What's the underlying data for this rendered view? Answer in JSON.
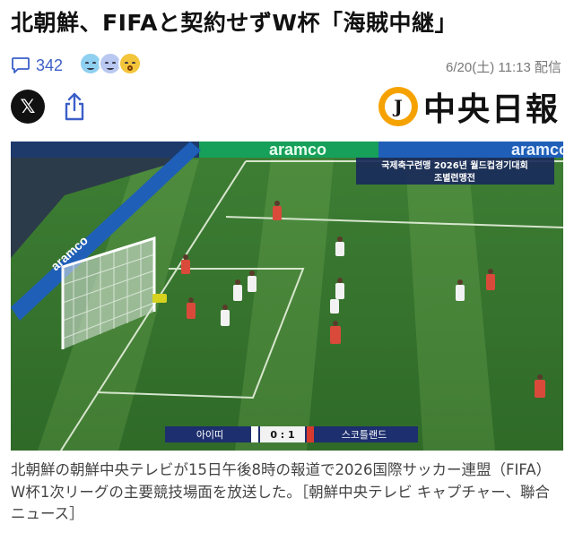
{
  "article": {
    "headline": "北朝鮮、FIFAと契約せずW杯「海賊中継」",
    "comment_count": "342",
    "date": "6/20(土) 11:13 配信",
    "caption": "北朝鮮の朝鮮中央テレビが15日午後8時の報道で2026国際サッカー連盟（FIFA）W杯1次リーグの主要競技場面を放送した。［朝鮮中央テレビ キャプチャー、聯合ニュース］"
  },
  "reactions": [
    {
      "icon": "smile-face-icon",
      "color": "#8fd0f0"
    },
    {
      "icon": "sad-face-icon",
      "color": "#b9c8f0"
    },
    {
      "icon": "surprised-face-icon",
      "color": "#f3c53a"
    }
  ],
  "share": {
    "x_label": "𝕏"
  },
  "publisher": {
    "logo_letter": "J",
    "name": "中央日報",
    "accent": "#f5a200"
  },
  "photo": {
    "ad_board_left": "aramco",
    "ad_board_top": "aramco",
    "ad_board_right": "aramco",
    "broadcast_line1": "국제축구련맹 2026년 월드컵경기대회",
    "broadcast_line2": "조별련맹전",
    "score_team_left": "아이띠",
    "score": "0 : 1",
    "score_team_right": "스코틀랜드"
  }
}
